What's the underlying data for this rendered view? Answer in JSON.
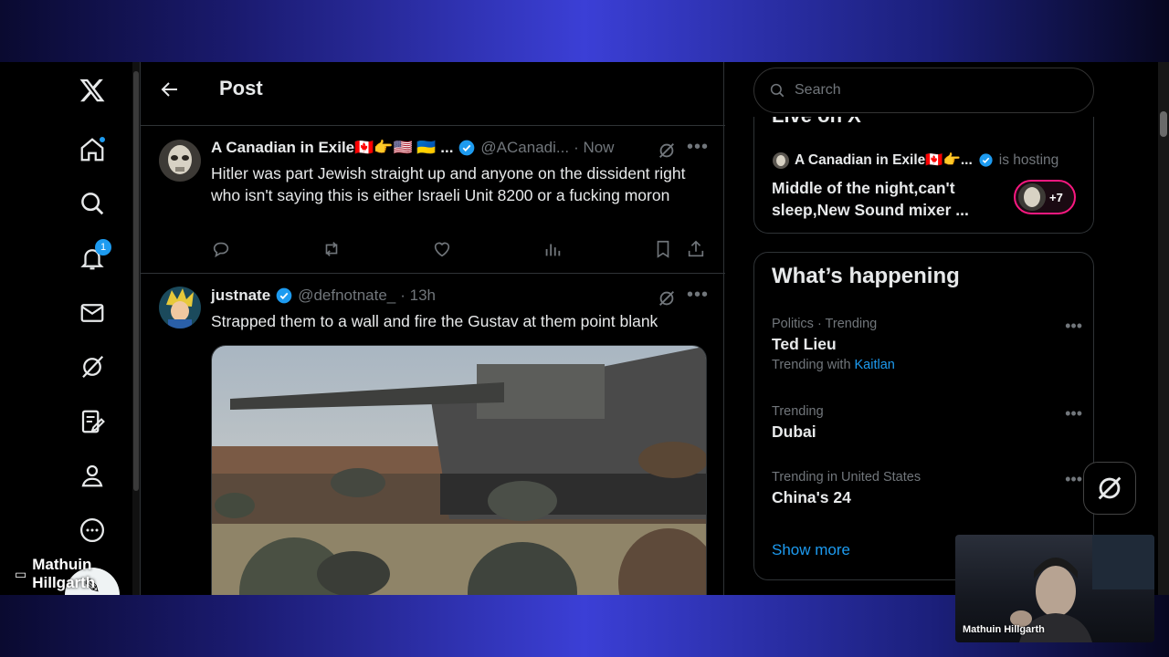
{
  "header": {
    "title": "Post"
  },
  "viewer": {
    "name": "Mathuin Hillgarth"
  },
  "nav": {
    "notifications_count": "1"
  },
  "tweets": [
    {
      "name": "A Canadian in Exile🇨🇦👉🇺🇸 🇺🇦 ...",
      "handle": "@ACanadi...",
      "time": "· Now",
      "text": "Hitler was part Jewish straight up and anyone on the dissident right who isn't saying this is either Israeli Unit 8200 or a fucking moron"
    },
    {
      "name": "justnate",
      "handle": "@defnotnate_",
      "time": "· 13h",
      "text": "Strapped them to a wall and fire the Gustav at them point blank"
    }
  ],
  "search": {
    "placeholder": "Search"
  },
  "live": {
    "title": "Live on X",
    "host_name": "A Canadian in Exile🇨🇦👉...",
    "host_suffix": "is hosting",
    "description": "Middle of the night,can't sleep,New Sound mixer ...",
    "listeners": "+7"
  },
  "happening": {
    "title": "What’s happening",
    "trends": [
      {
        "category": "Politics · Trending",
        "name": "Ted Lieu",
        "with_label": "Trending with",
        "with_link": "Kaitlan"
      },
      {
        "category": "Trending",
        "name": "Dubai"
      },
      {
        "category": "Trending in United States",
        "name": "China's 24"
      }
    ],
    "show_more": "Show more"
  },
  "webcam": {
    "label": "Mathuin Hillgarth"
  },
  "colors": {
    "accent": "#1d9bf0",
    "live": "#f91880",
    "background": "#000000"
  }
}
